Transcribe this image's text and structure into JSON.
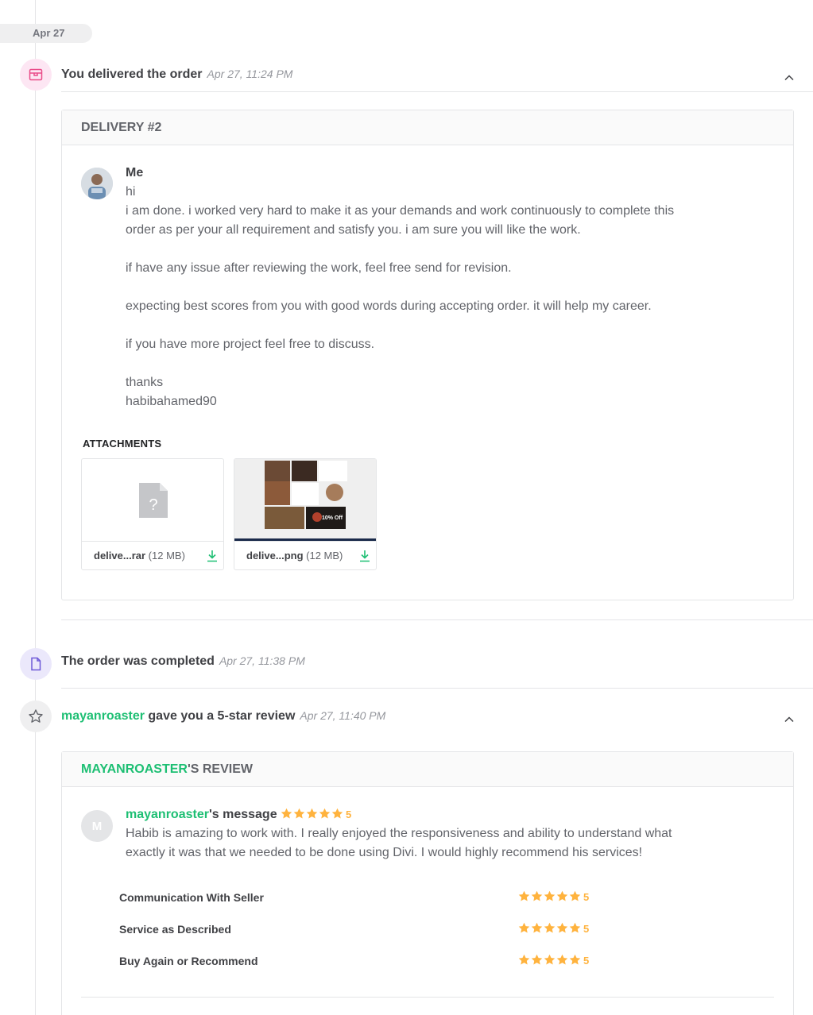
{
  "date_separator": "Apr 27",
  "events": {
    "delivered": {
      "title": "You delivered the order",
      "timestamp": "Apr 27, 11:24 PM",
      "icon": "package-icon"
    },
    "completed": {
      "title": "The order was completed",
      "timestamp": "Apr 27, 11:38 PM",
      "icon": "document-icon"
    },
    "review": {
      "user": "mayanroaster",
      "title_suffix": " gave you a 5-star review",
      "timestamp": "Apr 27, 11:40 PM",
      "icon": "star-outline-icon"
    }
  },
  "delivery": {
    "header": "DELIVERY #2",
    "sender": "Me",
    "message_lines": [
      "hi",
      "i am done. i worked very hard to make it as your demands and work continuously to complete this",
      "order as per your all requirement and satisfy you. i am sure you will like the work.",
      "",
      "if have any issue after reviewing the work, feel free send for revision.",
      "",
      "expecting best scores from you with good words during accepting order. it will help my career.",
      "",
      "if you have more project feel free to discuss.",
      "",
      "thanks",
      "habibahamed90"
    ],
    "attachments_title": "ATTACHMENTS",
    "attachments": [
      {
        "name": "delive...rar",
        "size": "(12 MB)",
        "type": "unknown",
        "preview_icon": "unknown-file-icon"
      },
      {
        "name": "delive...png",
        "size": "(12 MB)",
        "type": "image",
        "preview_caption": "10% Off"
      }
    ]
  },
  "review": {
    "header_user": "MAYANROASTER",
    "header_suffix": "'S REVIEW",
    "avatar_letter": "M",
    "reviewer": "mayanroaster",
    "message_suffix": "'s message",
    "overall_score": "5",
    "overall_stars": 5,
    "message_lines": [
      "Habib is amazing to work with. I really enjoyed the responsiveness and ability to understand what",
      "exactly it was that we needed to be done using Divi. I would highly recommend his services!"
    ],
    "ratings": [
      {
        "label": "Communication With Seller",
        "stars": 5,
        "score": "5"
      },
      {
        "label": "Service as Described",
        "stars": 5,
        "score": "5"
      },
      {
        "label": "Buy Again or Recommend",
        "stars": 5,
        "score": "5"
      }
    ]
  },
  "colors": {
    "accent_green": "#1dbf73",
    "star_orange": "#ffb33e",
    "pink_icon_bg": "#fde6f3",
    "purple_icon_bg": "#ebe8fb"
  }
}
